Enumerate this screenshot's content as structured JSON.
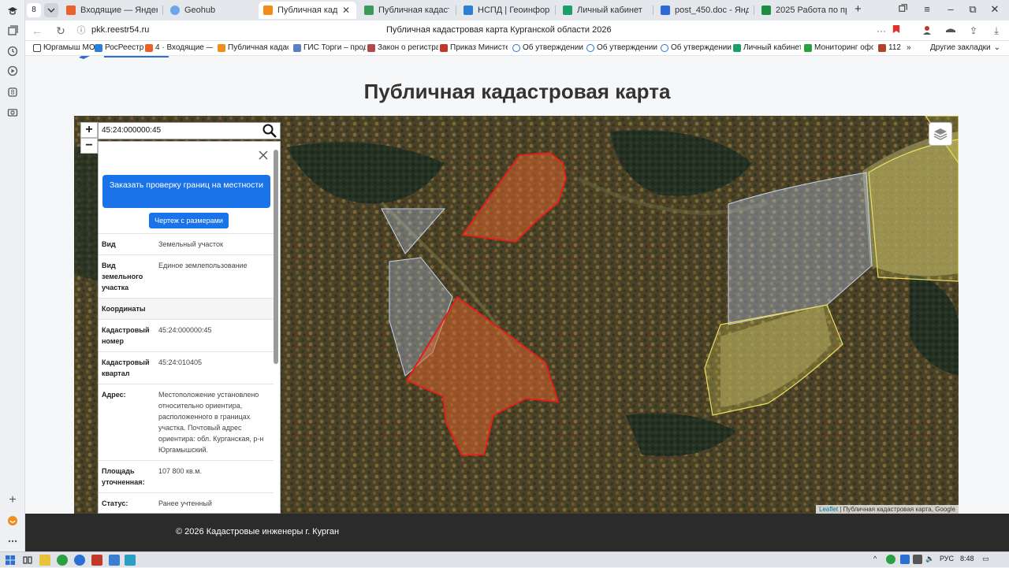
{
  "browser": {
    "tab_count": "8",
    "tabs": [
      {
        "label": "Входящие — Яндекс.Почта",
        "color": "#e8632b"
      },
      {
        "label": "Geohub",
        "color": "#6aa6e8"
      },
      {
        "label": "Публичная кадастровая карта",
        "color": "#f28c1a",
        "active": true
      },
      {
        "label": "Публичная кадастровая карта",
        "color": "#3b9a5c"
      },
      {
        "label": "НСПД | Геоинформационная",
        "color": "#2a7fd4"
      },
      {
        "label": "Личный кабинет",
        "color": "#1a9e6a"
      },
      {
        "label": "post_450.doc - Яндекс Документы",
        "color": "#2e6bd6"
      },
      {
        "label": "2025 Работа по предоставлению",
        "color": "#1e8e3e"
      }
    ],
    "url": "pkk.reestr54.ru",
    "page_title": "Публичная кадастровая карта Курганской области 2026",
    "bookmarks": [
      {
        "label": "Юргамыш МО",
        "color": "#444"
      },
      {
        "label": "РосРеестр",
        "color": "#2a7fd4"
      },
      {
        "label": "4 · Входящие — Я",
        "color": "#e8632b"
      },
      {
        "label": "Публичная кадаст",
        "color": "#f28c1a"
      },
      {
        "label": "ГИС Торги – прод",
        "color": "#5b7fc4"
      },
      {
        "label": "Закон о регистра",
        "color": "#b04a4a"
      },
      {
        "label": "Приказ Министер",
        "color": "#c0392b"
      },
      {
        "label": "Об утверждении",
        "color": "#2a6fd4"
      },
      {
        "label": "Об утверждении",
        "color": "#2a6fd4"
      },
      {
        "label": "Об утверждении",
        "color": "#2a6fd4"
      },
      {
        "label": "Личный кабинет",
        "color": "#1a9e6a"
      },
      {
        "label": "Мониторинг офо",
        "color": "#2aa043"
      },
      {
        "label": "112",
        "color": "#b0432b"
      }
    ],
    "bookmarks_more": "»",
    "other_bookmarks": "Другие закладки"
  },
  "page": {
    "heading": "Публичная кадастровая карта",
    "footer": "© 2026 Кадастровые инженеры г. Курган"
  },
  "map": {
    "search_value": "45:24:000000:45",
    "zoom_in": "+",
    "zoom_out": "−",
    "attribution_link": "Leaflet",
    "attribution_text": " | Публичная кадастровая карта, Google",
    "colors": {
      "selected_fill": "#d9622b",
      "selected_stroke": "#e0201a",
      "neighbor_yellow": "#e8e060",
      "neighbor_blue": "#b8c8e8"
    }
  },
  "info": {
    "order_button": "Заказать проверку границ на местности",
    "drawing_button": "Чертеж с размерами",
    "rows": [
      {
        "k": "Вид",
        "v": "Земельный участок"
      },
      {
        "k": "Вид земельного участка",
        "v": "Единое землепользование"
      },
      {
        "k": "Координаты",
        "v": ""
      },
      {
        "k": "Кадастровый номер",
        "v": "45:24:000000:45"
      },
      {
        "k": "Кадастровый квартал",
        "v": "45:24:010405"
      },
      {
        "k": "Адрес:",
        "v": "Местоположение установлено относительно ориентира, расположенного в границах участка. Почтовый адрес ориентира: обл. Курганская, р-н Юргамышский."
      },
      {
        "k": "Площадь уточненная:",
        "v": "107 800 кв.м."
      },
      {
        "k": "Статус:",
        "v": "Ранее учтенный"
      }
    ]
  },
  "taskbar": {
    "lang": "РУС",
    "time": "8:48"
  }
}
